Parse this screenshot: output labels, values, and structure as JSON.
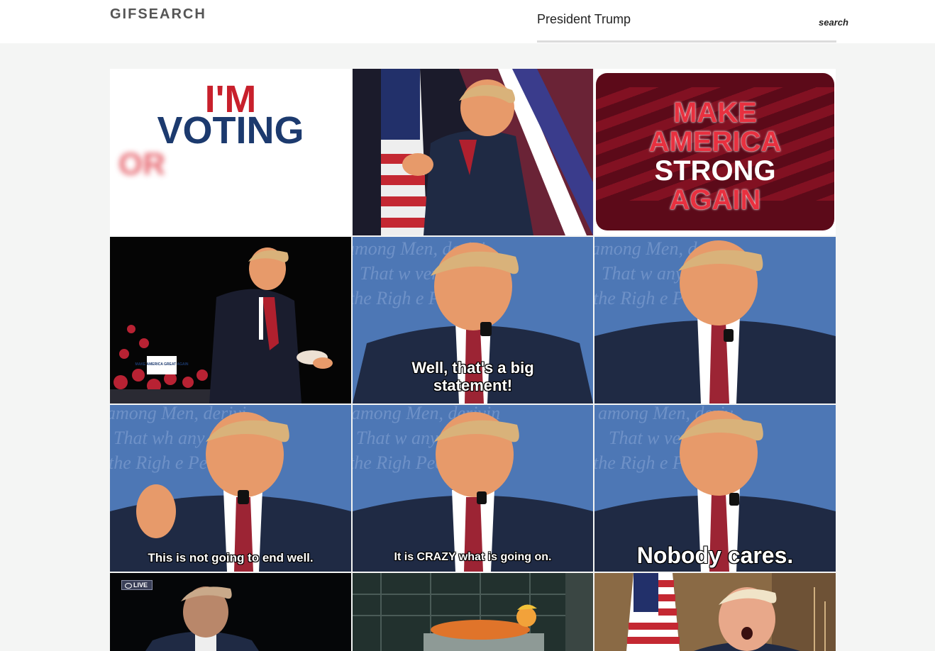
{
  "header": {
    "logo": "GIFSEARCH",
    "search": {
      "value": "President Trump",
      "button_label": "search"
    }
  },
  "results": [
    {
      "id": "gif-voting",
      "lines": [
        "I'M",
        "VOTING",
        "OR"
      ]
    },
    {
      "id": "gif-flag-hug"
    },
    {
      "id": "gif-maga",
      "lines": [
        "MAKE",
        "AMERICA",
        "STRONG",
        "AGAIN"
      ]
    },
    {
      "id": "gif-rally-dance",
      "sign": "MAKE AMERICA GREAT AGAIN"
    },
    {
      "id": "gif-debate-big-statement",
      "caption": "Well, that's a big statement!"
    },
    {
      "id": "gif-debate-face"
    },
    {
      "id": "gif-debate-end-well",
      "caption": "This is not going to end well."
    },
    {
      "id": "gif-debate-crazy",
      "caption": "It is CRAZY what is going on."
    },
    {
      "id": "gif-debate-nobody-cares",
      "caption": "Nobody cares."
    },
    {
      "id": "gif-live-news",
      "badge": "LIVE"
    },
    {
      "id": "gif-cartoon-bed"
    },
    {
      "id": "gif-snl-flag"
    }
  ],
  "colors": {
    "debate_bg": "#4d77b5",
    "suit": "#1f2a44",
    "hair": "#d9b27a",
    "skin": "#e79a6a",
    "tie_red": "#b0202e",
    "maga_bg": "#5c0a19",
    "maga_text": "#e8303f"
  }
}
